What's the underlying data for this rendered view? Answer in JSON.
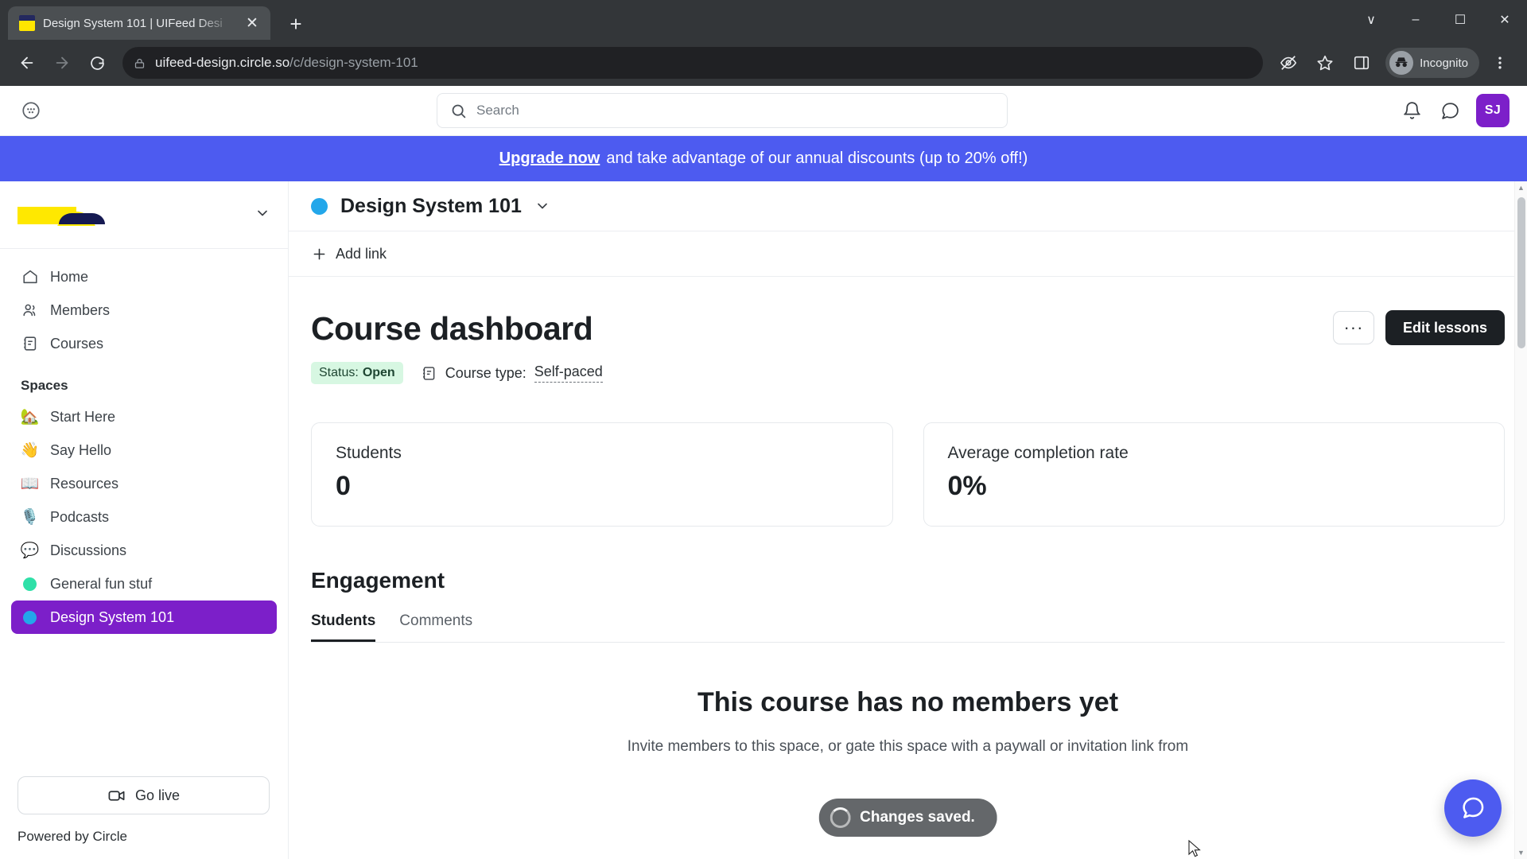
{
  "browser": {
    "tab": {
      "title": "Design System 101 | UIFeed Desi",
      "favicon_name": "site-favicon",
      "close_label": "✕"
    },
    "new_tab_label": "+",
    "window_controls": {
      "minimize": "–",
      "maximize": "☐",
      "close": "✕",
      "chevron": "∨"
    },
    "nav": {
      "back": "←",
      "forward": "→",
      "reload": "⟳"
    },
    "url": {
      "domain": "uifeed-design.circle.so",
      "path": "/c/design-system-101",
      "lock_icon": "lock-icon"
    },
    "omni": {
      "tracking_icon": "third-party-cookie-blocked-icon",
      "bookmark_icon": "star-icon",
      "sidepanel_icon": "side-panel-icon",
      "menu_icon": "kebab-menu-icon"
    },
    "incognito_label": "Incognito"
  },
  "topbar": {
    "apps_icon": "grid-apps-icon",
    "search_placeholder": "Search",
    "notifications_icon": "bell-icon",
    "messages_icon": "chat-bubble-icon",
    "avatar_initials": "SJ",
    "avatar_color": "#7c1fc9"
  },
  "banner": {
    "link_text": "Upgrade now",
    "text": "and take advantage of our annual discounts (up to 20% off!)",
    "bg_color": "#4d5bf0"
  },
  "sidebar": {
    "brand_logo_name": "uifeed-logo",
    "brand_chevron": "chevron-down-icon",
    "nav": [
      {
        "label": "Home",
        "icon": "home-icon"
      },
      {
        "label": "Members",
        "icon": "members-icon"
      },
      {
        "label": "Courses",
        "icon": "courses-icon"
      }
    ],
    "spaces_label": "Spaces",
    "spaces": [
      {
        "label": "Start Here",
        "emoji": "🏡",
        "type": "emoji"
      },
      {
        "label": "Say Hello",
        "emoji": "👋",
        "type": "emoji"
      },
      {
        "label": "Resources",
        "emoji": "📖",
        "type": "emoji"
      },
      {
        "label": "Podcasts",
        "emoji": "🎙️",
        "type": "emoji"
      },
      {
        "label": "Discussions",
        "emoji": "💬",
        "type": "emoji"
      },
      {
        "label": "General fun stuf",
        "color": "#2fe0a8",
        "type": "dot"
      },
      {
        "label": "Design System 101",
        "color": "#23a7ea",
        "type": "dot",
        "active": true
      }
    ],
    "go_live_label": "Go live",
    "go_live_icon": "video-camera-icon",
    "powered_by": "Powered by Circle"
  },
  "space_header": {
    "dot_color": "#23a7ea",
    "title": "Design System 101",
    "chevron": "chevron-down-icon"
  },
  "toolbar": {
    "add_link_label": "Add link",
    "add_link_icon": "plus-icon"
  },
  "dashboard": {
    "title": "Course dashboard",
    "status_prefix": "Status:",
    "status_value": "Open",
    "course_type_icon": "course-icon",
    "course_type_label": "Course type:",
    "course_type_value": "Self-paced",
    "more_button_label": "···",
    "edit_button_label": "Edit lessons",
    "stats": [
      {
        "label": "Students",
        "value": "0"
      },
      {
        "label": "Average completion rate",
        "value": "0%"
      }
    ],
    "engagement_title": "Engagement",
    "tabs": [
      {
        "label": "Students",
        "active": true
      },
      {
        "label": "Comments",
        "active": false
      }
    ],
    "empty_title": "This course has no members yet",
    "empty_sub": "Invite members to this space, or gate this space with a paywall or invitation link from"
  },
  "toast": {
    "message": "Changes saved.",
    "icon": "spinner-icon"
  },
  "chat_fab": {
    "icon": "chat-bubble-icon",
    "color": "#4d5bf0"
  }
}
